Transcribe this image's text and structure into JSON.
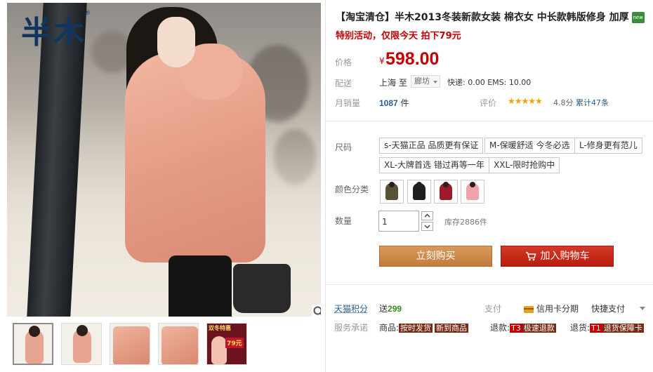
{
  "gallery": {
    "logo_text": "半木",
    "logo_mark": "®",
    "zoom_icon": "magnifier-icon",
    "thumbnails": [
      {
        "kind": "full",
        "active": true
      },
      {
        "kind": "full",
        "active": false
      },
      {
        "kind": "close",
        "active": false
      },
      {
        "kind": "close",
        "active": false
      },
      {
        "kind": "promo",
        "active": false,
        "promo_text": "双冬特惠",
        "promo_price": "79元"
      }
    ]
  },
  "product": {
    "title": "【淘宝清仓】半木2013冬装新款女装 棉衣女 中长款韩版修身 加厚",
    "new_badge": "new",
    "subtitle": "特别活动，仅限今天 拍下79元",
    "price_label": "价格",
    "currency": "¥",
    "price": "598.00",
    "shipping_label": "配送",
    "ship_from": "上海 至",
    "ship_to": "廊坊",
    "ship_fee": "快递: 0.00 EMS: 10.00",
    "sales_label": "月销量",
    "sales_count": "1087",
    "sales_unit": "件",
    "rating_label": "评价",
    "stars": "★★★★★",
    "rating_score": "4.8分",
    "reviews": "累计47条",
    "size_label": "尺码",
    "sizes": [
      "s-天猫正品 品质更有保证",
      "M-保暖舒适 今冬必选",
      "L-修身更有范儿",
      "XL-大牌首选 错过再等一年",
      "XXL-限时抢购中"
    ],
    "color_label": "颜色分类",
    "colors": [
      "#5a5236",
      "#1f1f22",
      "#9c1a2a",
      "#f0a2ab"
    ],
    "qty_label": "数量",
    "qty_value": "1",
    "stock": "库存2886件",
    "buy_now": "立刻购买",
    "add_cart": "加入购物车"
  },
  "footer": {
    "points_label": "天猫积分",
    "points_prefix": "送",
    "points_value": "299",
    "pay_label": "支付",
    "credit_text": "信用卡分期",
    "quick_pay": "快捷支付",
    "promise_label": "服务承诺",
    "promise_goods_label": "商品:",
    "promise_goods_tags": [
      "按时发货",
      "新到商品"
    ],
    "promise_refund_label": "退款:",
    "promise_refund_code": "T3",
    "promise_refund_tag": "极速退款",
    "promise_return_label": "退货:",
    "promise_return_code": "T1",
    "promise_return_tag": "退货保障卡"
  }
}
